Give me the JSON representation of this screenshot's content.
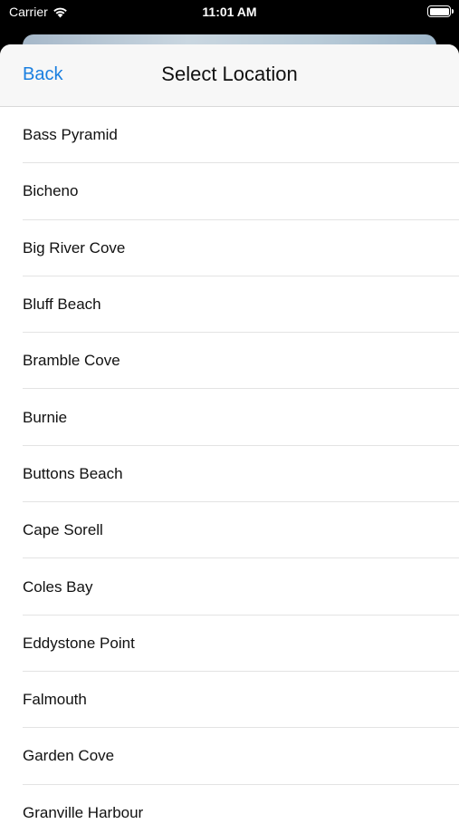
{
  "status_bar": {
    "carrier": "Carrier",
    "time": "11:01 AM",
    "wifi_icon": "wifi-icon",
    "battery_icon": "battery-icon"
  },
  "nav": {
    "back_label": "Back",
    "title": "Select Location"
  },
  "locations": [
    "Bass Pyramid",
    "Bicheno",
    "Big River Cove",
    "Bluff Beach",
    "Bramble Cove",
    "Burnie",
    "Buttons Beach",
    "Cape Sorell",
    "Coles Bay",
    "Eddystone Point",
    "Falmouth",
    "Garden Cove",
    "Granville Harbour"
  ],
  "colors": {
    "accent": "#1a7fe0",
    "nav_background": "#f7f7f7",
    "separator": "#e3e3e3"
  }
}
